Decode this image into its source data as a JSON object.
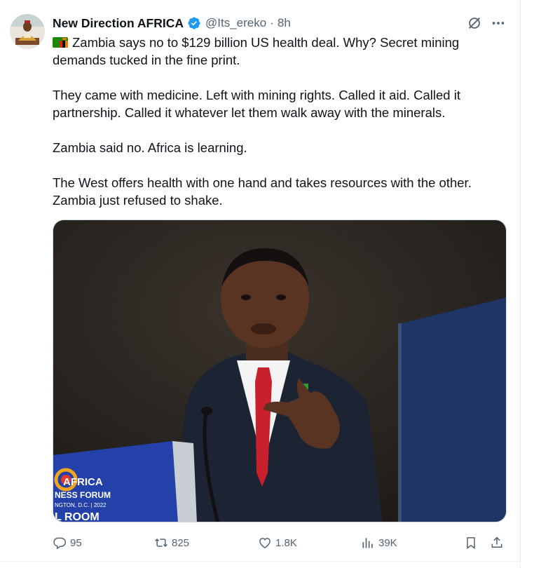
{
  "author": {
    "display_name": "New Direction AFRICA",
    "handle": "@Its_ereko",
    "separator": "·",
    "time": "8h",
    "avatar_icon": "profile-avatar",
    "verified_icon": "verified-badge-icon"
  },
  "tweet": {
    "flag_icon": "zambia-flag-icon",
    "paragraphs": [
      "Zambia says no to $129 billion US health deal. Why? Secret mining demands tucked in the fine print.",
      "They came with medicine. Left with mining rights. Called it aid. Called it partnership. Called it whatever let them walk away with the minerals.",
      "Zambia said no. Africa is learning.",
      "The West offers health with one hand and takes resources with the other. Zambia just refused to shake."
    ]
  },
  "media": {
    "podium_lines": [
      "AFRICA",
      "NESS FORUM",
      "NGTON, D.C. | 2022",
      "L ROOM"
    ]
  },
  "actions": {
    "reply_count": "95",
    "repost_count": "825",
    "like_count": "1.8K",
    "views_count": "39K"
  },
  "colors": {
    "text_primary": "#0f1419",
    "text_secondary": "#536471",
    "verified_blue": "#1d9bf0",
    "border": "#cfd9de"
  }
}
